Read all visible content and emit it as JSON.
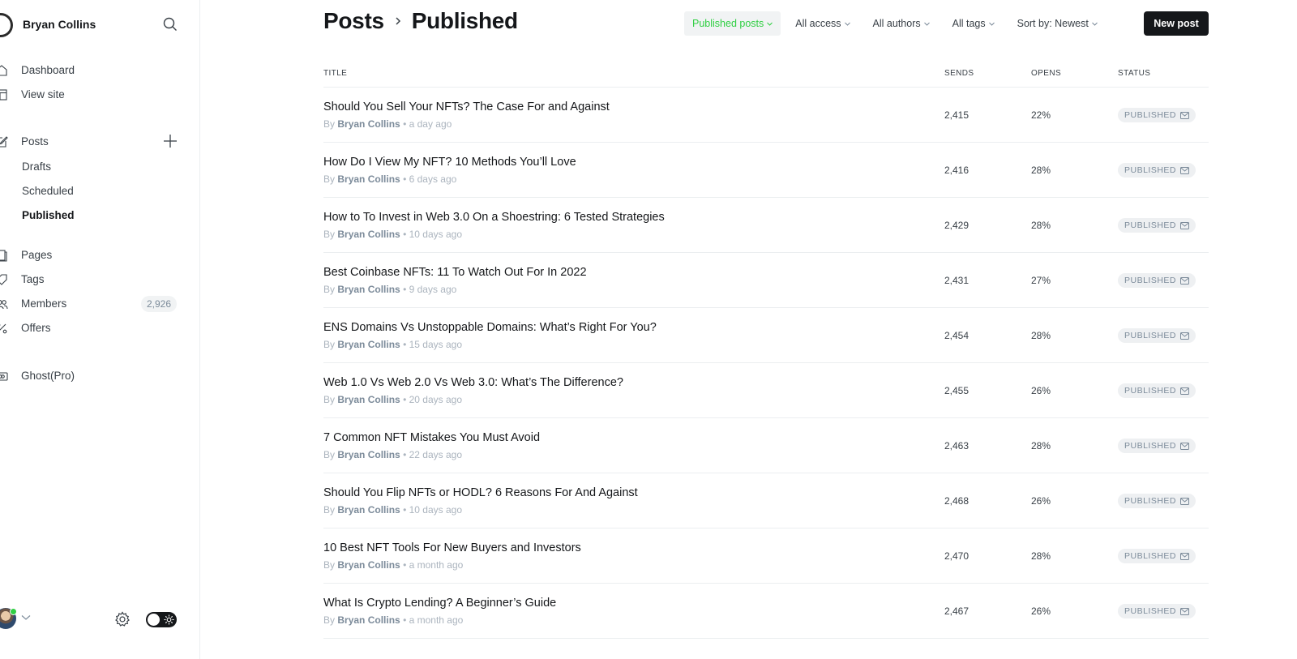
{
  "sidebar": {
    "brand_name": "Bryan Collins",
    "nav": [
      {
        "label": "Dashboard",
        "icon": "home-icon"
      },
      {
        "label": "View site",
        "icon": "layout-icon"
      }
    ],
    "posts": {
      "label": "Posts",
      "sub": [
        {
          "label": "Drafts"
        },
        {
          "label": "Scheduled"
        },
        {
          "label": "Published",
          "active": true
        }
      ]
    },
    "nav2": [
      {
        "label": "Pages",
        "icon": "pages-icon"
      },
      {
        "label": "Tags",
        "icon": "tag-icon"
      },
      {
        "label": "Members",
        "icon": "members-icon",
        "count": "2,926"
      },
      {
        "label": "Offers",
        "icon": "percent-icon"
      }
    ],
    "ghost_pro": {
      "label": "Ghost(Pro)",
      "icon": "credit-card-icon"
    }
  },
  "header": {
    "breadcrumb_parent": "Posts",
    "breadcrumb_current": "Published",
    "filters": [
      {
        "label": "Published posts",
        "active": true
      },
      {
        "label": "All access"
      },
      {
        "label": "All authors"
      },
      {
        "label": "All tags"
      },
      {
        "label": "Sort by: Newest"
      }
    ],
    "new_post_label": "New post"
  },
  "colors": {
    "accent": "#30cf43",
    "primary_button": "#15171a"
  },
  "table": {
    "columns": {
      "title": "TITLE",
      "sends": "SENDS",
      "opens": "OPENS",
      "status": "STATUS"
    },
    "by_label": "By",
    "rows": [
      {
        "title": "Should You Sell Your NFTs? The Case For and Against",
        "author": "Bryan Collins",
        "time": "a day ago",
        "sends": "2,415",
        "opens": "22%",
        "status": "PUBLISHED"
      },
      {
        "title": "How Do I View My NFT? 10 Methods You’ll Love",
        "author": "Bryan Collins",
        "time": "6 days ago",
        "sends": "2,416",
        "opens": "28%",
        "status": "PUBLISHED"
      },
      {
        "title": "How to To Invest in Web 3.0 On a Shoestring: 6 Tested Strategies",
        "author": "Bryan Collins",
        "time": "10 days ago",
        "sends": "2,429",
        "opens": "28%",
        "status": "PUBLISHED"
      },
      {
        "title": "Best Coinbase NFTs: 11 To Watch Out For In 2022",
        "author": "Bryan Collins",
        "time": "9 days ago",
        "sends": "2,431",
        "opens": "27%",
        "status": "PUBLISHED"
      },
      {
        "title": "ENS Domains Vs Unstoppable Domains: What’s Right For You?",
        "author": "Bryan Collins",
        "time": "15 days ago",
        "sends": "2,454",
        "opens": "28%",
        "status": "PUBLISHED"
      },
      {
        "title": "Web 1.0 Vs Web 2.0 Vs Web 3.0: What’s The Difference?",
        "author": "Bryan Collins",
        "time": "20 days ago",
        "sends": "2,455",
        "opens": "26%",
        "status": "PUBLISHED"
      },
      {
        "title": "7 Common NFT Mistakes You Must Avoid",
        "author": "Bryan Collins",
        "time": "22 days ago",
        "sends": "2,463",
        "opens": "28%",
        "status": "PUBLISHED"
      },
      {
        "title": "Should You Flip NFTs or HODL? 6 Reasons For And Against",
        "author": "Bryan Collins",
        "time": "10 days ago",
        "sends": "2,468",
        "opens": "26%",
        "status": "PUBLISHED"
      },
      {
        "title": "10 Best NFT Tools For New Buyers and Investors",
        "author": "Bryan Collins",
        "time": "a month ago",
        "sends": "2,470",
        "opens": "28%",
        "status": "PUBLISHED"
      },
      {
        "title": "What Is Crypto Lending? A Beginner’s Guide",
        "author": "Bryan Collins",
        "time": "a month ago",
        "sends": "2,467",
        "opens": "26%",
        "status": "PUBLISHED"
      }
    ]
  }
}
